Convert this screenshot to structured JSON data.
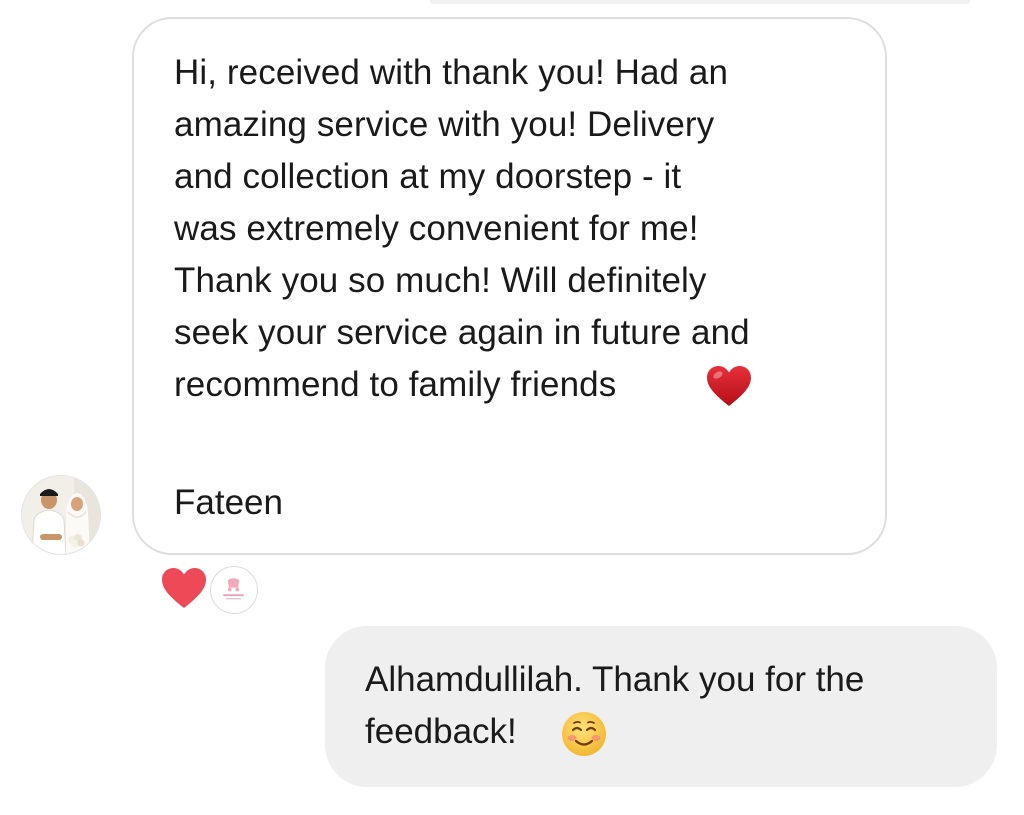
{
  "conversation": {
    "incoming": {
      "text": "Hi, received with thank you! Had an\namazing service with you! Delivery\nand collection at my doorstep - it\nwas extremely convenient for me!\nThank you so much! Will definitely\nseek your service again in future and\nrecommend to family friends",
      "emoji": "red-heart",
      "signature": "Fateen"
    },
    "reactions": [
      {
        "type": "heart-reaction",
        "color": "#ed4956"
      },
      {
        "type": "reactor-avatar"
      }
    ],
    "outgoing": {
      "text": "Alhamdullilah. Thank you for the\nfeedback!",
      "emoji": "smiling-face"
    }
  },
  "colors": {
    "bubble_in_border": "#dedede",
    "bubble_out_bg": "#efefef",
    "heart": "#d41923",
    "reaction_heart": "#ed4956",
    "emoji_face": "#f5c33b"
  },
  "icons": {
    "avatar": "couple-photo-avatar",
    "reaction_avatar": "shop-logo-avatar"
  }
}
